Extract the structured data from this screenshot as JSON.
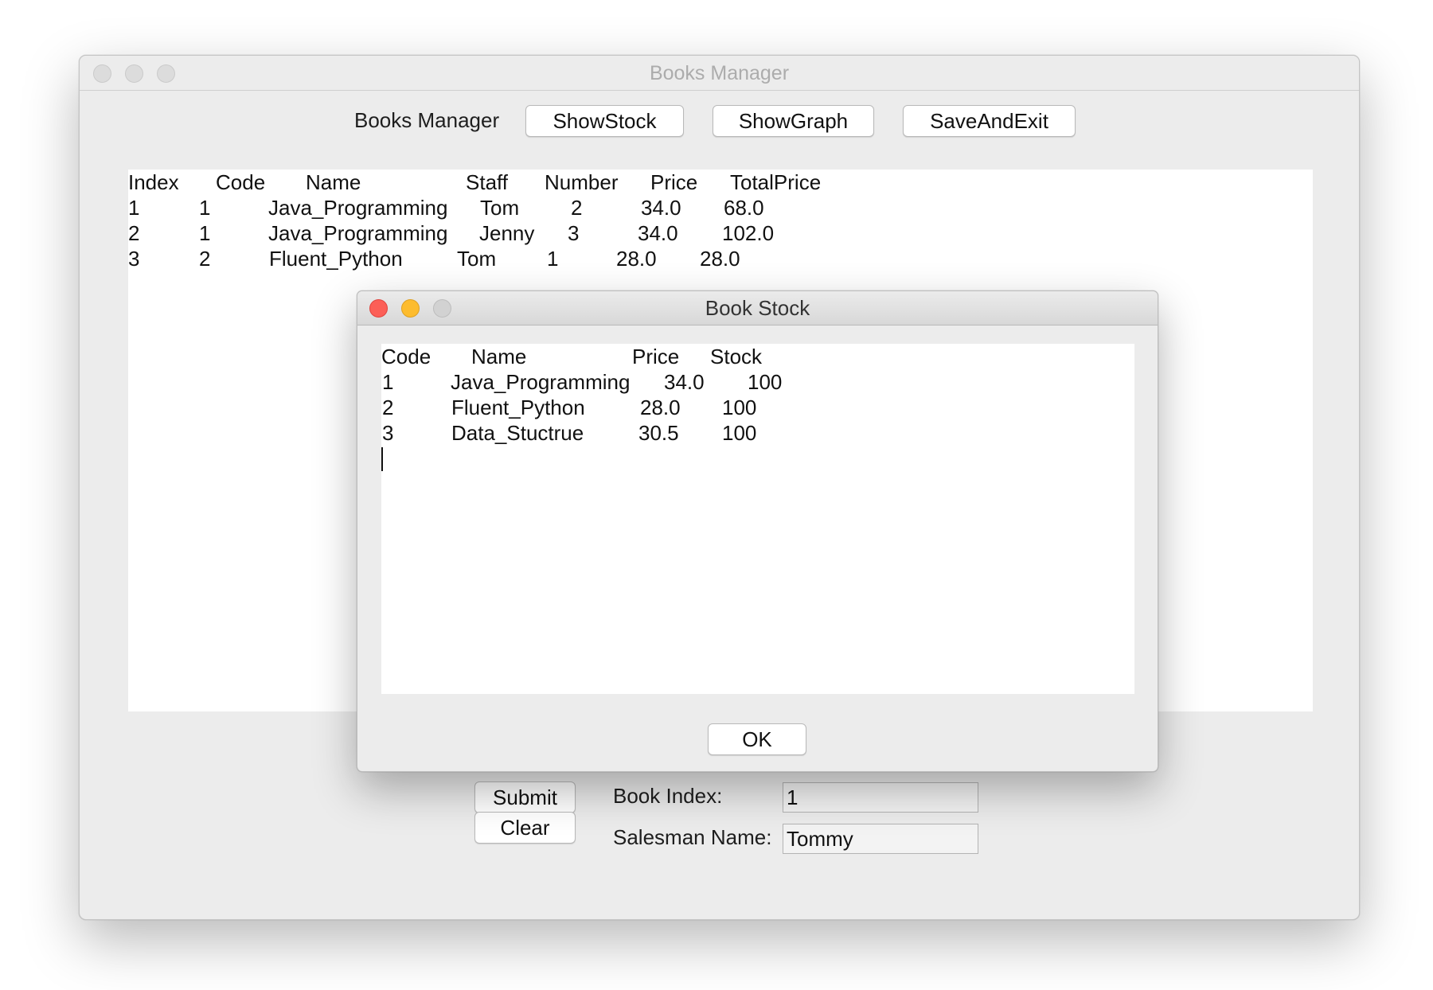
{
  "main_window": {
    "title": "Books Manager",
    "header_label": "Books Manager",
    "buttons": {
      "show_stock": "ShowStock",
      "show_graph": "ShowGraph",
      "save_and_exit": "SaveAndExit",
      "submit_partial": "Submit",
      "clear": "Clear"
    },
    "sales_table": {
      "headers": [
        "Index",
        "Code",
        "Name",
        "Staff",
        "Number",
        "Price",
        "TotalPrice"
      ],
      "rows": [
        [
          "1",
          "1",
          "Java_Programming",
          "Tom",
          "2",
          "34.0",
          "68.0"
        ],
        [
          "2",
          "1",
          "Java_Programming",
          "Jenny",
          "3",
          "34.0",
          "102.0"
        ],
        [
          "3",
          "2",
          "Fluent_Python",
          "Tom",
          "1",
          "28.0",
          "28.0"
        ]
      ]
    },
    "form": {
      "book_index_label": "Book Index:",
      "book_index_value": "1",
      "salesman_label": "Salesman Name:",
      "salesman_value": "Tommy"
    }
  },
  "dialog": {
    "title": "Book Stock",
    "stock_table": {
      "headers": [
        "Code",
        "Name",
        "Price",
        "Stock"
      ],
      "rows": [
        [
          "1",
          "Java_Programming",
          "34.0",
          "100"
        ],
        [
          "2",
          "Fluent_Python",
          "28.0",
          "100"
        ],
        [
          "3",
          "Data_Stuctrue",
          "30.5",
          "100"
        ]
      ]
    },
    "ok_label": "OK"
  },
  "colors": {
    "window_bg": "#ececec",
    "close": "#fc5f57",
    "minimize": "#fdbc2e",
    "inactive_light": "#dcdcdc"
  }
}
